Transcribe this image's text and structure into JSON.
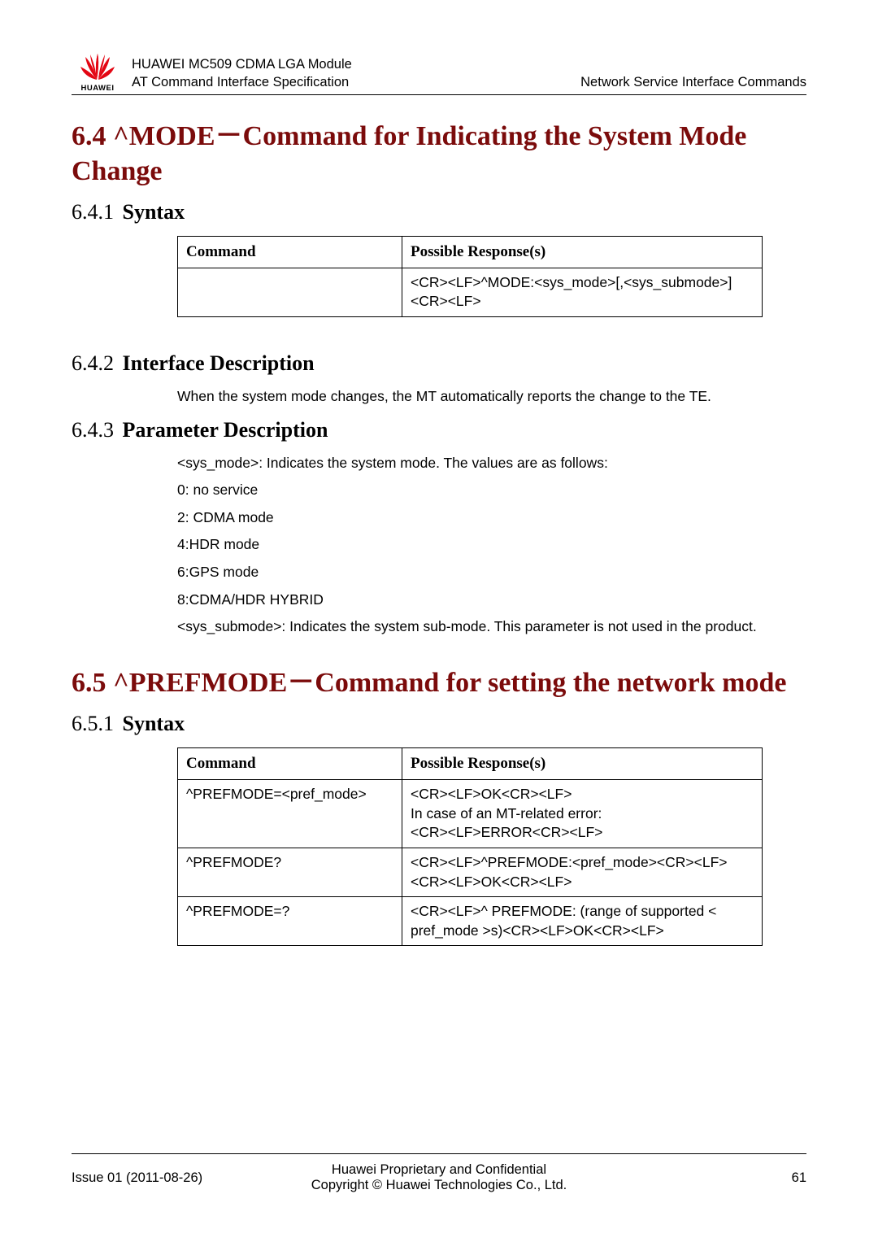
{
  "logo": {
    "brand": "HUAWEI"
  },
  "header": {
    "line1": "HUAWEI MC509 CDMA LGA Module",
    "line2": "AT Command Interface Specification",
    "right": "Network Service Interface Commands"
  },
  "sec64": {
    "title": "6.4 ^MODE－Command for Indicating the System Mode Change",
    "s1": {
      "num": "6.4.1",
      "title": "Syntax"
    },
    "table": {
      "h1": "Command",
      "h2": "Possible Response(s)",
      "r1c1": "",
      "r1c2": "<CR><LF>^MODE:<sys_mode>[,<sys_submode>]<CR><LF>"
    },
    "s2": {
      "num": "6.4.2",
      "title": "Interface Description"
    },
    "s2p1": "When the system mode changes, the MT automatically reports the change to the TE.",
    "s3": {
      "num": "6.4.3",
      "title": "Parameter Description"
    },
    "s3p1": "<sys_mode>: Indicates the system mode. The values are as follows:",
    "s3p2": "0: no service",
    "s3p3": "2: CDMA mode",
    "s3p4": "4:HDR mode",
    "s3p5": "6:GPS mode",
    "s3p6": "8:CDMA/HDR HYBRID",
    "s3p7": "<sys_submode>: Indicates the system sub-mode. This parameter is not used in the product."
  },
  "sec65": {
    "title": "6.5 ^PREFMODE－Command for setting the network mode",
    "s1": {
      "num": "6.5.1",
      "title": "Syntax"
    },
    "table": {
      "h1": "Command",
      "h2": "Possible Response(s)",
      "rows": [
        {
          "cmd": "^PREFMODE=<pref_mode>",
          "resp_l1": "<CR><LF>OK<CR><LF>",
          "resp_l2": "In case of an MT-related error:",
          "resp_l3": "<CR><LF>ERROR<CR><LF>"
        },
        {
          "cmd": "^PREFMODE?",
          "resp_l1": "<CR><LF>^PREFMODE:<pref_mode><CR><LF>",
          "resp_l2": "<CR><LF>OK<CR><LF>"
        },
        {
          "cmd": "^PREFMODE=?",
          "resp_l1": "<CR><LF>^ PREFMODE: (range of supported < pref_mode >s)<CR><LF>OK<CR><LF>"
        }
      ]
    }
  },
  "footer": {
    "left": "Issue 01 (2011-08-26)",
    "center1": "Huawei Proprietary and Confidential",
    "center2": "Copyright © Huawei Technologies Co., Ltd.",
    "right": "61"
  }
}
